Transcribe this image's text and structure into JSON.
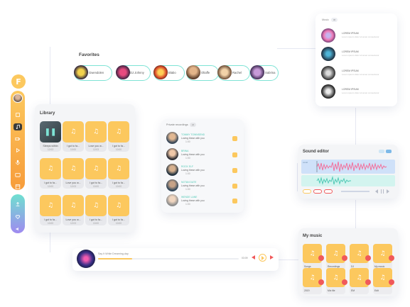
{
  "colors": {
    "accent_yellow": "#fcc85e",
    "accent_teal": "#7ee3d5",
    "accent_pink": "#f2719d",
    "accent_red": "#f0595a",
    "rail_orange": "#f9b44a"
  },
  "favorites": {
    "title": "Favorites",
    "items": [
      {
        "name": "Gwendolen"
      },
      {
        "name": "DJ Johnny"
      },
      {
        "name": "Blabo"
      },
      {
        "name": "Oltaffe"
      },
      {
        "name": "Rachel"
      },
      {
        "name": "Sabrina"
      }
    ]
  },
  "library": {
    "title": "Library",
    "tiles": [
      {
        "title": "Sleeps within",
        "meta": "12:03"
      },
      {
        "title": "I got to fa...",
        "meta": "10:00"
      },
      {
        "title": "Love you w...",
        "meta": "12:03"
      },
      {
        "title": "I got to fa...",
        "meta": "10:00"
      },
      {
        "title": "I got to fa...",
        "meta": "10:00"
      },
      {
        "title": "Love you w...",
        "meta": "12:03"
      },
      {
        "title": "I got to fa...",
        "meta": "10:00"
      },
      {
        "title": "I got to fa...",
        "meta": "10:00"
      },
      {
        "title": "I got to fa...",
        "meta": "10:00"
      },
      {
        "title": "Love you w...",
        "meta": "12:03"
      },
      {
        "title": "I got to fa...",
        "meta": "10:00"
      },
      {
        "title": "I got to fa...",
        "meta": "10:00"
      }
    ]
  },
  "private_recordings": {
    "title": "Private recordings",
    "count": "24",
    "rows": [
      {
        "name": "TOMMY TOWNSEND",
        "subtitle": "Loving these with you",
        "time": "1:00"
      },
      {
        "name": "BRINA",
        "subtitle": "Loving these with you",
        "time": "1:00"
      },
      {
        "name": "ROCK ELF",
        "subtitle": "Loving these with you",
        "time": "1:00"
      },
      {
        "name": "NOTAN DATE",
        "subtitle": "Loving these with you",
        "time": "1:00"
      },
      {
        "name": "WENDE LANE",
        "subtitle": "Loving these with you",
        "time": "1:00"
      }
    ]
  },
  "player": {
    "track": "Say It While Dreaming-day",
    "time": "03:09"
  },
  "music_list": {
    "title": "Music",
    "count": "36",
    "items": [
      {
        "title": "LOREM IPSUM",
        "desc": "Lorem ipsum dolor sit amet consectetur"
      },
      {
        "title": "LOREM IPSUM",
        "desc": "Lorem ipsum dolor sit amet consectetur"
      },
      {
        "title": "LOREM IPSUM",
        "desc": "Lorem ipsum dolor sit amet consectetur"
      },
      {
        "title": "LOREM IPSUM",
        "desc": "Lorem ipsum dolor sit amet consectetur"
      }
    ]
  },
  "sound_editor": {
    "title": "Sound editor",
    "track_label": "vocal"
  },
  "my_music": {
    "title": "My music",
    "items": [
      {
        "label": "Songs"
      },
      {
        "label": "Recordings"
      },
      {
        "label": "DJ"
      },
      {
        "label": "My music"
      },
      {
        "label": "2019"
      },
      {
        "label": "Mix file"
      },
      {
        "label": "EM"
      },
      {
        "label": "Edit"
      }
    ]
  },
  "logo_letter": "F"
}
